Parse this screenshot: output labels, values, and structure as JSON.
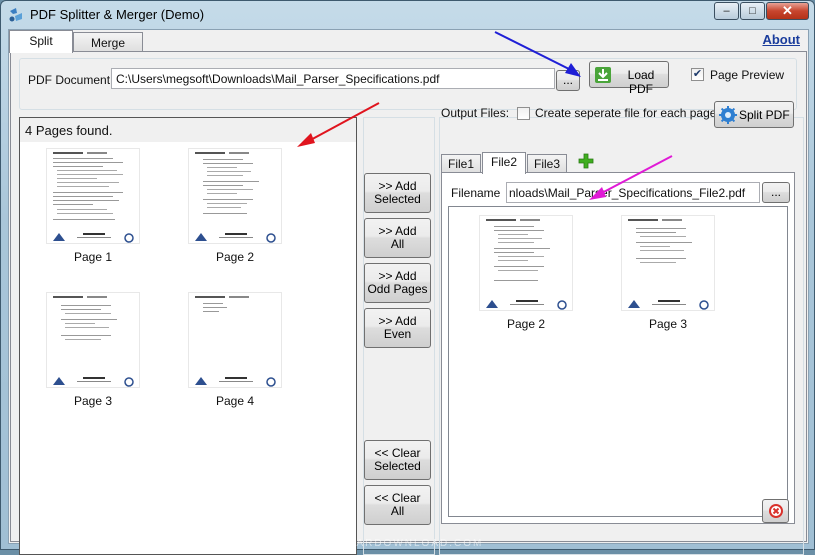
{
  "window": {
    "title": "PDF Splitter & Merger (Demo)",
    "min_glyph": "–",
    "max_glyph": "□",
    "close_glyph": "✕"
  },
  "tabs": [
    {
      "label": "Split",
      "active": true
    },
    {
      "label": "Merge",
      "active": false
    }
  ],
  "about_label": "About",
  "doc": {
    "label": "PDF Document",
    "path": "C:\\Users\\megsoft\\Downloads\\Mail_Parser_Specifications.pdf",
    "browse_label": "...",
    "load_label": "Load PDF",
    "preview_label": "Page Preview",
    "preview_checked": "✔"
  },
  "left": {
    "header": "4 Pages found.",
    "pages": [
      {
        "label": "Page 1"
      },
      {
        "label": "Page 2"
      },
      {
        "label": "Page 3"
      },
      {
        "label": "Page 4"
      }
    ]
  },
  "mid": {
    "add_selected": [
      ">> Add",
      "Selected"
    ],
    "add_all": [
      ">> Add",
      "All"
    ],
    "add_odd": [
      ">> Add",
      "Odd Pages"
    ],
    "add_even": [
      ">> Add",
      "Even"
    ],
    "clear_selected": [
      "<< Clear",
      "Selected"
    ],
    "clear_all": [
      "<< Clear",
      "All"
    ]
  },
  "right": {
    "output_label": "Output Files:",
    "separate_label": "Create seperate file for each page",
    "split_label": "Split PDF",
    "file_tabs": [
      {
        "label": "File1"
      },
      {
        "label": "File2"
      },
      {
        "label": "File3"
      }
    ],
    "filename_label": "Filename",
    "filename_value": "nloads\\Mail_Parser_Specifications_File2.pdf",
    "browse_label": "...",
    "pages": [
      {
        "label": "Page 2"
      },
      {
        "label": "Page 3"
      }
    ]
  },
  "watermark": "GEARDOWNLOAD.COM",
  "colors": {
    "accent_blue": "#1a3c9c",
    "arrow_red": "#e0141e",
    "arrow_blue": "#1f1fd6",
    "arrow_magenta": "#e01ad6",
    "plus_green": "#3fae1f"
  },
  "icons": {
    "app": "app-icon",
    "load": "download-icon",
    "split": "gear-icon",
    "add": "plus-icon",
    "delete": "close-circle-icon"
  }
}
